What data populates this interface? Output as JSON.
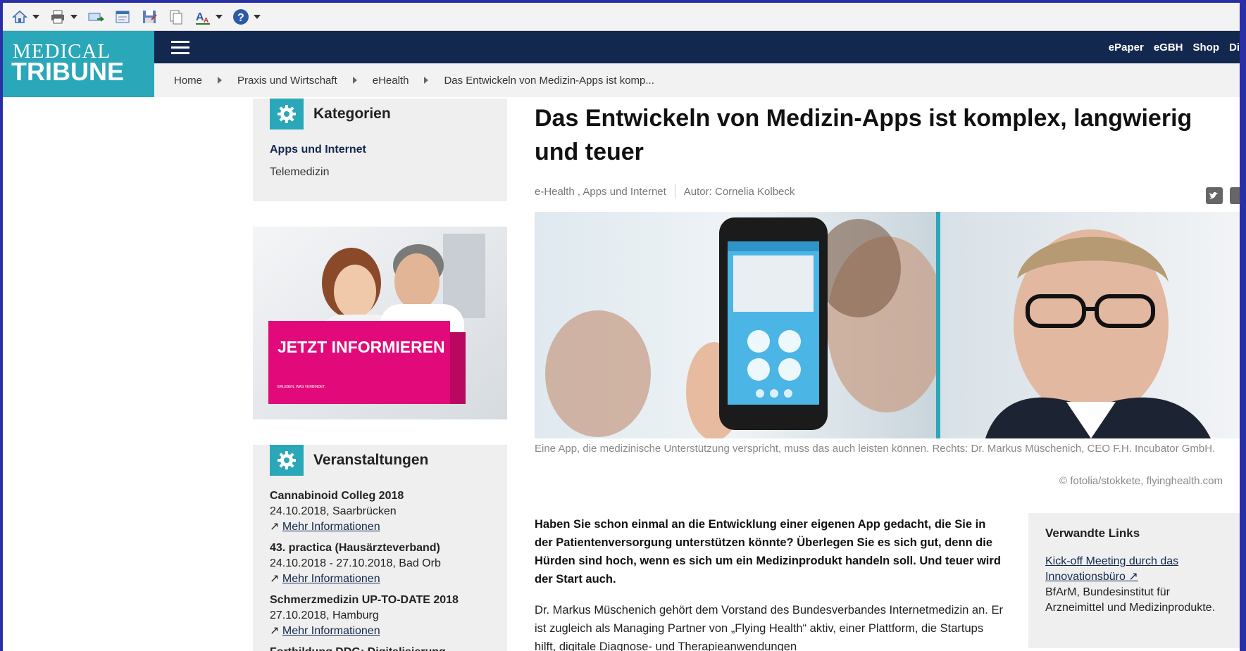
{
  "toolbar": {
    "buttons": [
      {
        "icon": "home-icon"
      },
      {
        "icon": "print-icon"
      },
      {
        "icon": "mail-icon"
      },
      {
        "icon": "page-icon"
      },
      {
        "icon": "save-icon"
      },
      {
        "icon": "copy-icon"
      },
      {
        "icon": "text-size-icon"
      },
      {
        "icon": "help-icon"
      }
    ]
  },
  "logo": {
    "line1": "MEDICAL",
    "line2": "TRIBUNE"
  },
  "topnav": {
    "items": [
      "ePaper",
      "eGBH",
      "Shop",
      "Di"
    ]
  },
  "breadcrumb": {
    "items": [
      "Home",
      "Praxis und Wirtschaft",
      "eHealth",
      "Das Entwickeln von Medizin-Apps ist komp..."
    ]
  },
  "categories": {
    "title": "Kategorien",
    "items": [
      {
        "label": "Apps und Internet",
        "active": true
      },
      {
        "label": "Telemedizin",
        "active": false
      }
    ]
  },
  "ad": {
    "cta": "JETZT INFORMIEREN",
    "small": "ERLEBEN, WAS VERBINDET."
  },
  "events": {
    "title": "Veranstaltungen",
    "items": [
      {
        "title": "Cannabinoid Colleg 2018",
        "details": "24.10.2018, Saarbrücken",
        "link": "Mehr Informationen"
      },
      {
        "title": "43. practica (Hausärzteverband)",
        "details": "24.10.2018 - 27.10.2018, Bad Orb",
        "link": "Mehr Informationen"
      },
      {
        "title": "Schmerzmedizin UP-TO-DATE 2018",
        "details": "27.10.2018, Hamburg",
        "link": "Mehr Informationen"
      },
      {
        "title": "Fortbildung DDG: Digitalisierung",
        "details": "",
        "link": ""
      }
    ]
  },
  "article": {
    "title": "Das Entwickeln von Medizin-Apps ist komplex, langwierig und teuer",
    "categories": "e-Health , Apps und Internet",
    "author": "Autor: Cornelia Kolbeck",
    "caption": "Eine App, die medizinische Unterstützung verspricht, muss das auch leisten können. Rechts: Dr. Markus Müschenich, CEO F.H. Incubator GmbH.",
    "credit": "© fotolia/stokkete, flyinghealth.com",
    "lead": "Haben Sie schon einmal an die Entwicklung einer eigenen App gedacht, die Sie in der Patientenversorgung unterstützen könnte? Überlegen Sie es sich gut, denn die Hürden sind hoch, wenn es sich um ein Medizinprodukt handeln soll. Und teuer wird der Start auch.",
    "body": "Dr. Markus Müschenich gehört dem Vorstand des Bundesverbandes Internetmedizin an. Er ist zugleich als Managing Partner von „Flying Health“ aktiv, einer Plattform, die Startups hilft, digitale Diagnose- und Therapieanwendungen"
  },
  "related": {
    "title": "Verwandte Links",
    "link": "Kick-off Meeting durch das Innovationsbüro",
    "text": "BfArM, Bundesinstitut für Arzneimittel und Medizinprodukte."
  }
}
